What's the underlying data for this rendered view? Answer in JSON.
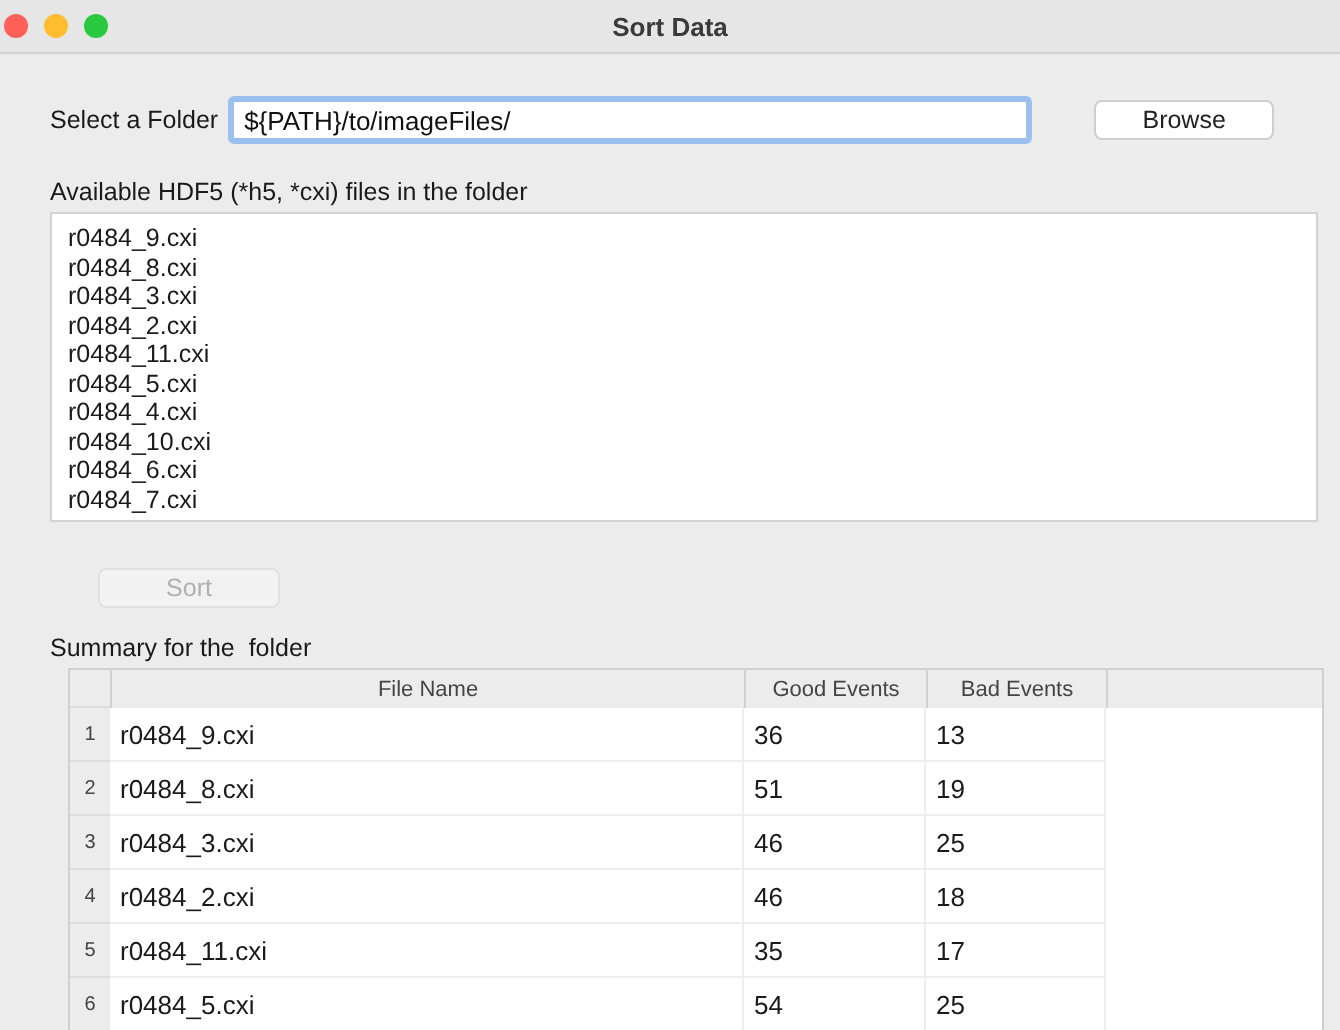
{
  "window": {
    "title": "Sort Data"
  },
  "folder": {
    "label": "Select a Folder",
    "value": "${PATH}/to/imageFiles/",
    "browse_button": "Browse"
  },
  "files": {
    "label": "Available HDF5 (*h5, *cxi) files in the folder",
    "items": [
      "r0484_9.cxi",
      "r0484_8.cxi",
      "r0484_3.cxi",
      "r0484_2.cxi",
      "r0484_11.cxi",
      "r0484_5.cxi",
      "r0484_4.cxi",
      "r0484_10.cxi",
      "r0484_6.cxi",
      "r0484_7.cxi"
    ]
  },
  "sort_button": {
    "label": "Sort",
    "disabled": true
  },
  "summary": {
    "label": "Summary for the  folder",
    "table": {
      "columns": [
        "File Name",
        "Good Events",
        "Bad Events"
      ],
      "rows": [
        {
          "index": "1",
          "cells": [
            "r0484_9.cxi",
            "36",
            "13"
          ]
        },
        {
          "index": "2",
          "cells": [
            "r0484_8.cxi",
            "51",
            "19"
          ]
        },
        {
          "index": "3",
          "cells": [
            "r0484_3.cxi",
            "46",
            "25"
          ]
        },
        {
          "index": "4",
          "cells": [
            "r0484_2.cxi",
            "46",
            "18"
          ]
        },
        {
          "index": "5",
          "cells": [
            "r0484_11.cxi",
            "35",
            "17"
          ]
        },
        {
          "index": "6",
          "cells": [
            "r0484_5.cxi",
            "54",
            "25"
          ]
        }
      ]
    }
  }
}
